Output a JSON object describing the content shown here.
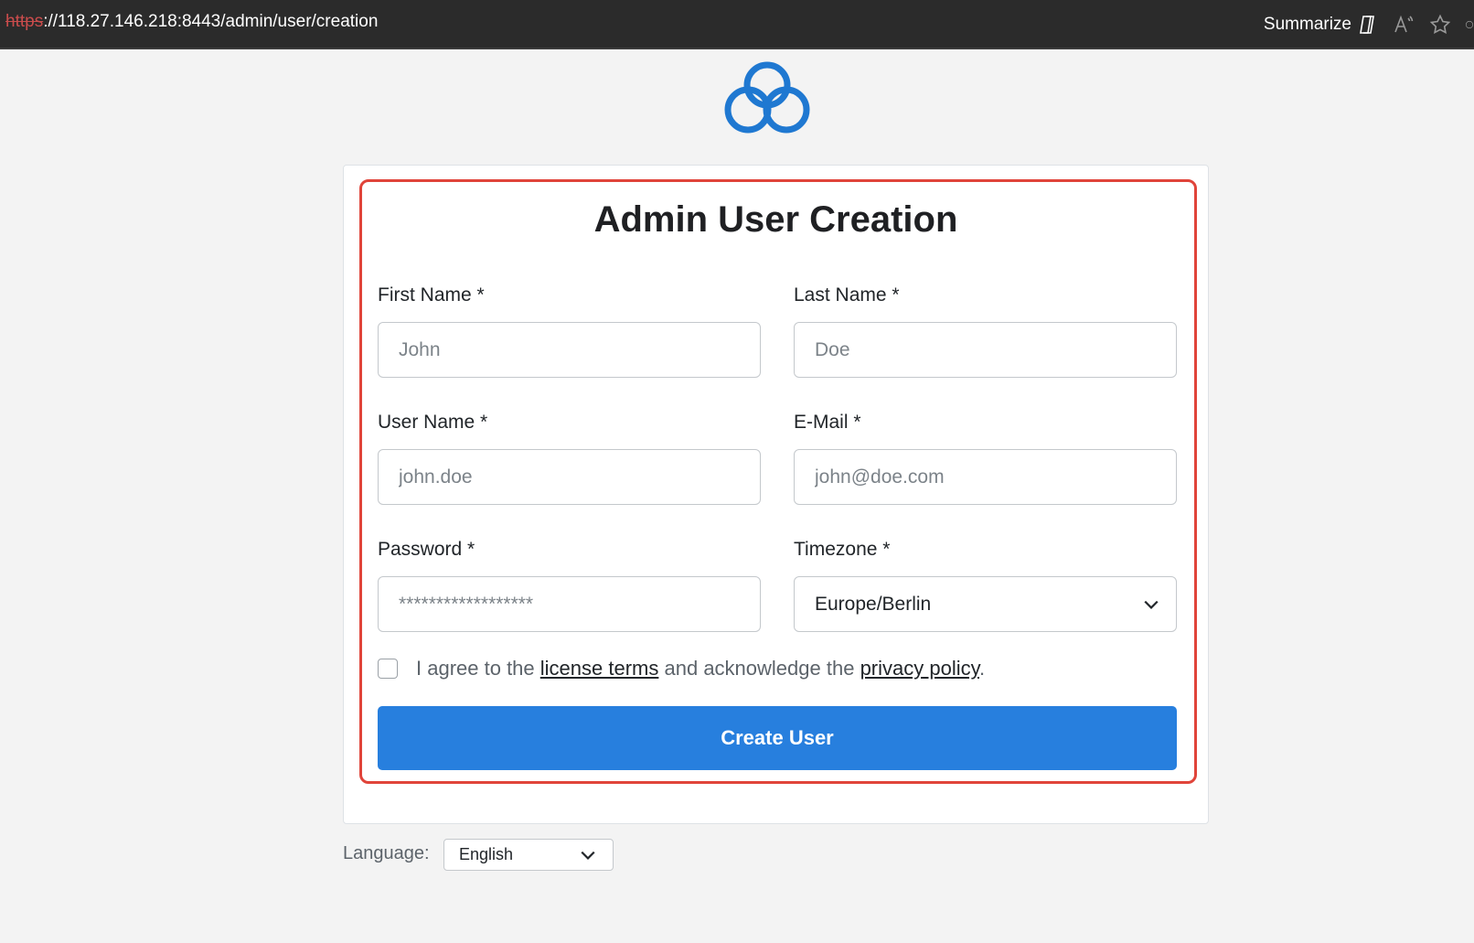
{
  "browser": {
    "url_scheme": "https",
    "url_rest": "://118.27.146.218:8443/admin/user/creation",
    "summarize_label": "Summarize",
    "icons": [
      "copilot-icon",
      "read-aloud-icon",
      "favorite-star-icon"
    ]
  },
  "form": {
    "title": "Admin User Creation",
    "first_name": {
      "label": "First Name *",
      "placeholder": "John"
    },
    "last_name": {
      "label": "Last Name *",
      "placeholder": "Doe"
    },
    "user_name": {
      "label": "User Name *",
      "placeholder": "john.doe"
    },
    "email": {
      "label": "E-Mail *",
      "placeholder": "john@doe.com"
    },
    "password": {
      "label": "Password *",
      "placeholder": "******************"
    },
    "timezone": {
      "label": "Timezone *",
      "value": "Europe/Berlin"
    },
    "agree": {
      "prefix": "I agree to the",
      "license_link": "license terms",
      "middle": "and acknowledge the",
      "privacy_link": "privacy policy",
      "suffix": ".",
      "checked": false
    },
    "submit_label": "Create User"
  },
  "footer": {
    "language_label": "Language:",
    "language_value": "English"
  },
  "colors": {
    "brand": "#1f78d1",
    "button": "#277fde",
    "highlight": "#e0443a"
  }
}
